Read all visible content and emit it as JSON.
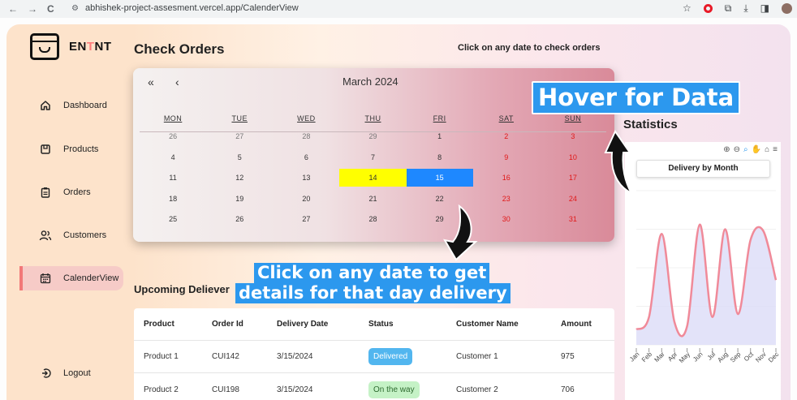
{
  "browser": {
    "url": "abhishek-project-assesment.vercel.app/CalenderView",
    "nav_back": "←",
    "nav_forward": "→",
    "nav_reload": "C",
    "tune_icon": "tune-icon",
    "star": "☆",
    "ext": "⧉",
    "download": "⤓",
    "sidepanel": "◨"
  },
  "brand": {
    "name_prefix": "EN",
    "name_accent": "T",
    "name_suffix": "NT"
  },
  "sidebar": {
    "items": [
      {
        "label": "Dashboard",
        "icon": "home-icon"
      },
      {
        "label": "Products",
        "icon": "box-icon"
      },
      {
        "label": "Orders",
        "icon": "clipboard-icon"
      },
      {
        "label": "Customers",
        "icon": "users-icon"
      },
      {
        "label": "CalenderView",
        "icon": "calendar-icon",
        "active": true
      }
    ],
    "logout": {
      "label": "Logout",
      "icon": "logout-icon"
    }
  },
  "main": {
    "title": "Check Orders",
    "hint": "Click on any date to check orders",
    "upcoming": "Upcoming Deliever",
    "stats_title": "Statistics"
  },
  "calendar": {
    "month": "March 2024",
    "prev_year": "«",
    "prev_month": "‹",
    "days_of_week": [
      "MON",
      "TUE",
      "WED",
      "THU",
      "FRI",
      "SAT",
      "SUN"
    ],
    "weeks": [
      [
        "26",
        "27",
        "28",
        "29",
        "1",
        "2",
        "3"
      ],
      [
        "4",
        "5",
        "6",
        "7",
        "8",
        "9",
        "10"
      ],
      [
        "11",
        "12",
        "13",
        "14",
        "15",
        "16",
        "17"
      ],
      [
        "18",
        "19",
        "20",
        "21",
        "22",
        "23",
        "24"
      ],
      [
        "25",
        "26",
        "27",
        "28",
        "29",
        "30",
        "31"
      ]
    ],
    "highlight_yellow": "14",
    "highlight_blue": "15",
    "colors": {
      "yellow": "#ffff00",
      "blue": "#1e88ff",
      "weekend": "#e01818"
    }
  },
  "table": {
    "headers": [
      "Product",
      "Order Id",
      "Delivery Date",
      "Status",
      "Customer Name",
      "Amount"
    ],
    "rows": [
      [
        "Product 1",
        "CUI142",
        "3/15/2024",
        "Delivered",
        "Customer 1",
        "975"
      ],
      [
        "Product 2",
        "CUI198",
        "3/15/2024",
        "On the way",
        "Customer 2",
        "706"
      ]
    ],
    "status_colors": {
      "Delivered": "#52b6ef",
      "On the way": "#c5f2c6"
    }
  },
  "toolbar": {
    "zoom_in": "⊕",
    "zoom_out": "⊖",
    "search": "⌕",
    "pan": "✋",
    "home": "⌂",
    "menu": "≡"
  },
  "chart_data": {
    "type": "area",
    "title": "Delivery by Month",
    "categories": [
      "Jan",
      "Feb",
      "Mar",
      "Apr",
      "May",
      "Jun",
      "Jul",
      "Aug",
      "Sep",
      "Oct",
      "Nov",
      "Dec"
    ],
    "values": [
      10,
      18,
      72,
      15,
      12,
      78,
      18,
      75,
      20,
      68,
      74,
      42
    ],
    "ylim": [
      0,
      100
    ],
    "line_color": "#f08a99",
    "fill_color": "#dcdcf8"
  },
  "overlays": {
    "hover_callout": "Hover for Data",
    "click_callout_line1": "Click on any date to get",
    "click_callout_line2": "details for that day delivery",
    "callout_color": "#2c98ee"
  }
}
